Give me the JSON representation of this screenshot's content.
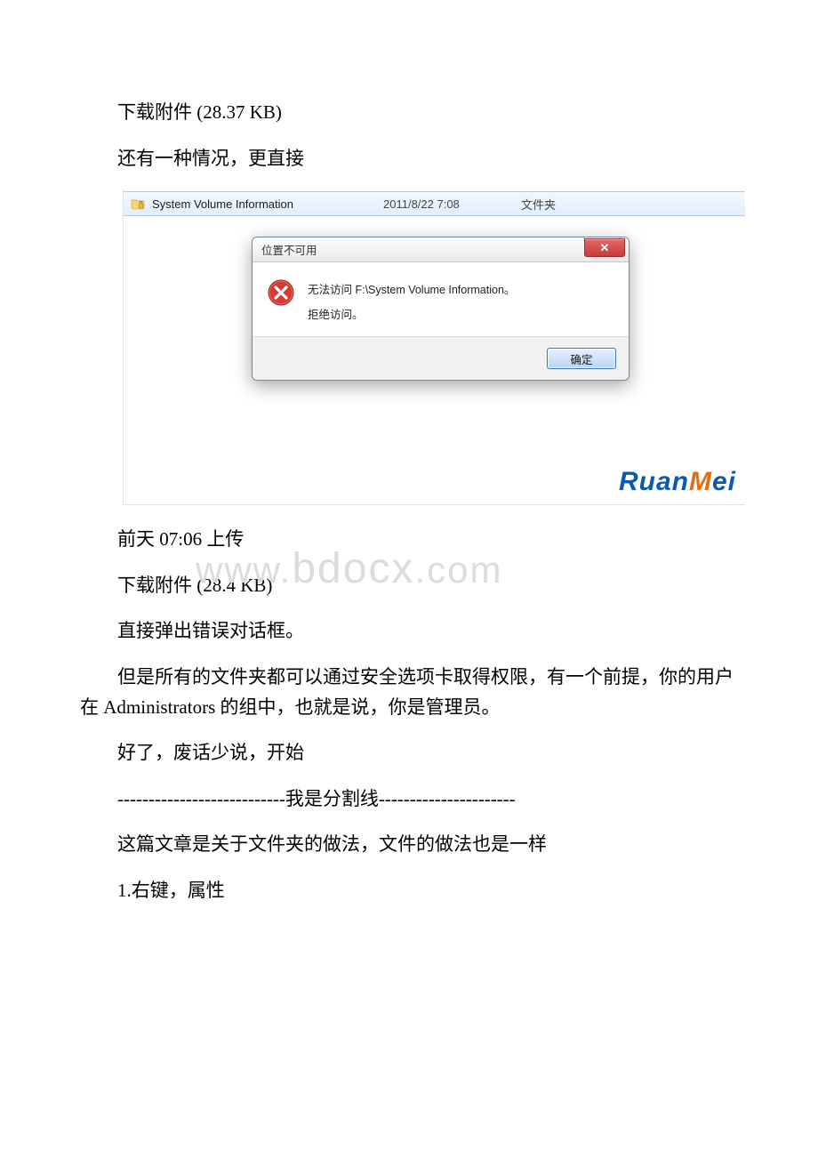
{
  "paragraphs": {
    "p1": "下载附件 (28.37 KB)",
    "p2": "还有一种情况，更直接",
    "p3": "前天 07:06 上传",
    "p4": "下载附件 (28.4 KB)",
    "p5": "直接弹出错误对话框。",
    "p6": "但是所有的文件夹都可以通过安全选项卡取得权限，有一个前提，你的用户在 Administrators 的组中，也就是说，你是管理员。",
    "p7": "好了，废话少说，开始",
    "p8": "---------------------------我是分割线----------------------",
    "p9": "这篇文章是关于文件夹的做法，文件的做法也是一样",
    "p10": "1.右键，属性"
  },
  "figure": {
    "folder_row": {
      "name": "System Volume Information",
      "date": "2011/8/22 7:08",
      "type": "文件夹"
    },
    "dialog": {
      "title": "位置不可用",
      "close_symbol": "✕",
      "line1": "无法访问 F:\\System Volume Information。",
      "line2": "拒绝访问。",
      "ok_label": "确定"
    },
    "logo_text": "RuanMei"
  },
  "watermark": "www.bdocx.com"
}
